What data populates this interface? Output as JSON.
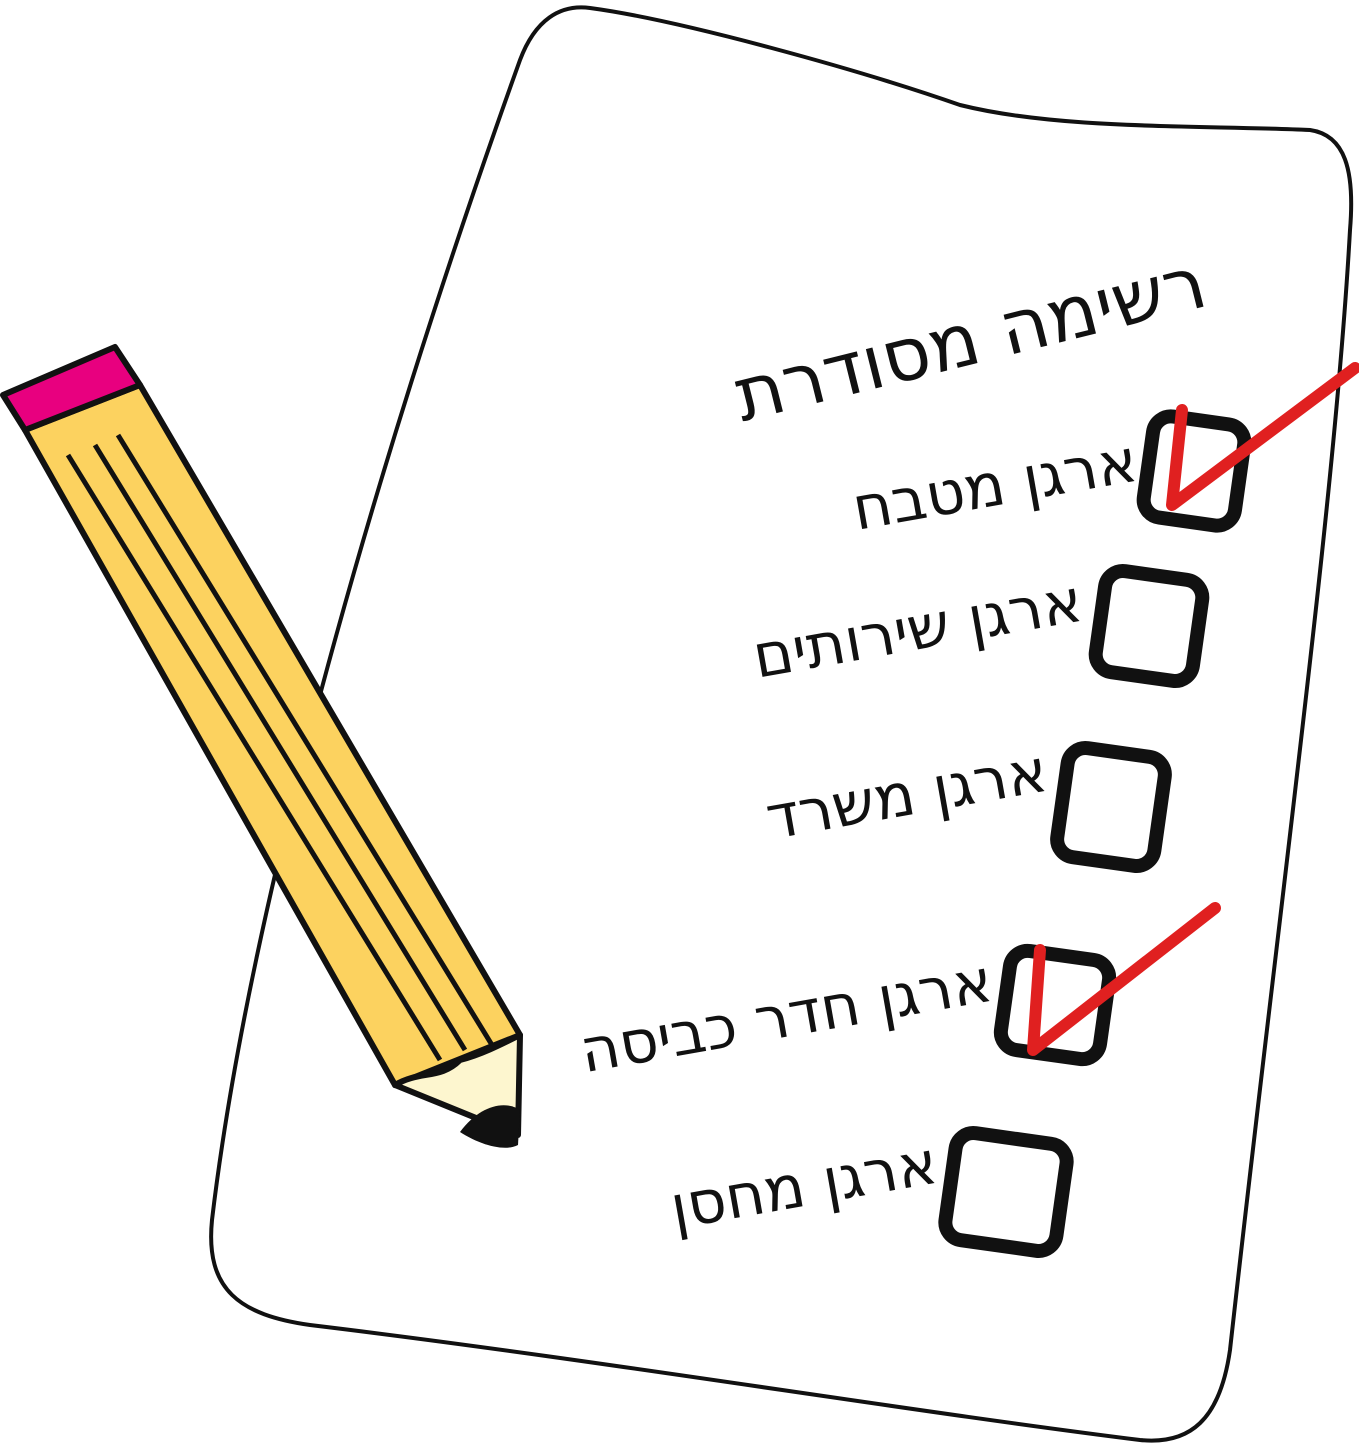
{
  "list": {
    "title_line1": "רשימה מסודרת",
    "title_line2": "",
    "items": [
      {
        "label": "ארגן מטבח",
        "checked": true
      },
      {
        "label": "ארגן שירותים",
        "checked": false
      },
      {
        "label": "ארגן משרד",
        "checked": false
      },
      {
        "label": "ארגן חדר כביסה",
        "checked": true
      },
      {
        "label": "ארגן מחסן",
        "checked": false
      }
    ]
  },
  "colors": {
    "paper": "#ffffff",
    "ink": "#111111",
    "check": "#e02020",
    "pencil_body": "#fcd25f",
    "pencil_eraser": "#e8007f",
    "pencil_wood": "#fdf6cf"
  }
}
